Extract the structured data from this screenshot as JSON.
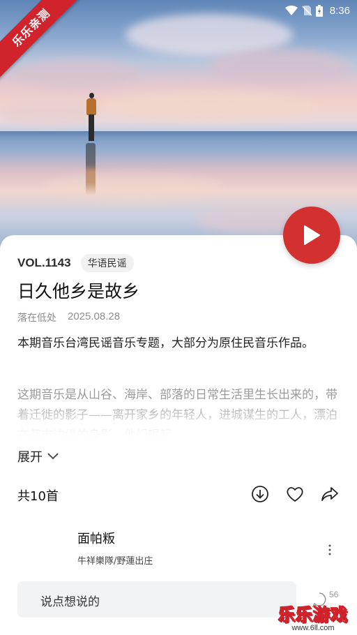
{
  "status_bar": {
    "time": "8:36"
  },
  "ribbon": {
    "text": "乐乐亲测"
  },
  "episode": {
    "volume": "VOL.1143",
    "genre_tag": "华语民谣",
    "title": "日久他乡是故乡",
    "author": "落在低处",
    "date": "2025.08.28",
    "intro": "本期音乐台湾民谣音乐专题，大部分为原住民音乐作品。",
    "description": "这期音乐是从山谷、海岸、部落的日常生活里生长出来的，带着迁徙的影子——离开家乡的年轻人，进城谋生的工人，漂泊在都市边缘的身影，他们唱起",
    "expand_label": "展开"
  },
  "tracklist": {
    "count_label": "共10首",
    "songs": [
      {
        "title": "面帕粄",
        "artist": "牛祥樂隊/野蓮出庄"
      }
    ]
  },
  "comment": {
    "placeholder": "说点想说的",
    "count": "56"
  },
  "watermark": {
    "title": "乐乐游戏",
    "url": "www.6ll.com"
  },
  "colors": {
    "accent": "#d2312f",
    "ribbon": "#d0232b"
  }
}
